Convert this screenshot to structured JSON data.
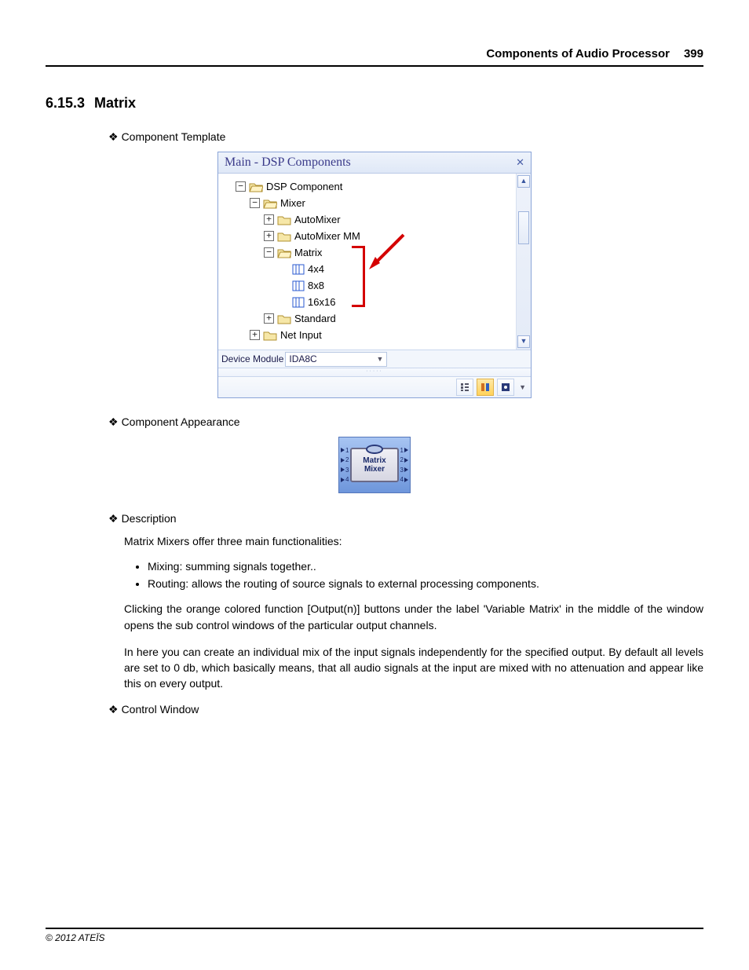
{
  "header": {
    "title": "Components of Audio Processor",
    "page": "399"
  },
  "section": {
    "num": "6.15.3",
    "title": "Matrix"
  },
  "labels": {
    "tpl": "Component Template",
    "appear": "Component Appearance",
    "desc": "Description",
    "ctrl": "Control Window"
  },
  "dsp": {
    "title": "Main - DSP Components",
    "tree": {
      "root": "DSP Component",
      "mixer": "Mixer",
      "automixer": "AutoMixer",
      "automixer_mm": "AutoMixer MM",
      "matrix": "Matrix",
      "m4": "4x4",
      "m8": "8x8",
      "m16": "16x16",
      "standard": "Standard",
      "netinput": "Net Input"
    },
    "device_label": "Device Module",
    "device_value": "IDA8C"
  },
  "chip": {
    "line1": "Matrix",
    "line2": "Mixer",
    "ports": [
      "1",
      "2",
      "3",
      "4"
    ]
  },
  "desc": {
    "intro": "Matrix Mixers offer three main functionalities:",
    "b1": "Mixing: summing signals together..",
    "b2": "Routing: allows the routing of source signals to external processing components.",
    "p1": "Clicking the orange colored function [Output(n)] buttons under the label 'Variable Matrix' in the middle of the window opens the sub control windows of the particular output channels.",
    "p2": "In here you can create an individual mix of the input signals independently for the specified output. By default all levels are set to 0 db, which basically means, that all audio signals at the input are mixed with no attenuation and appear like this on every output."
  },
  "footer": "© 2012 ATEÏS"
}
